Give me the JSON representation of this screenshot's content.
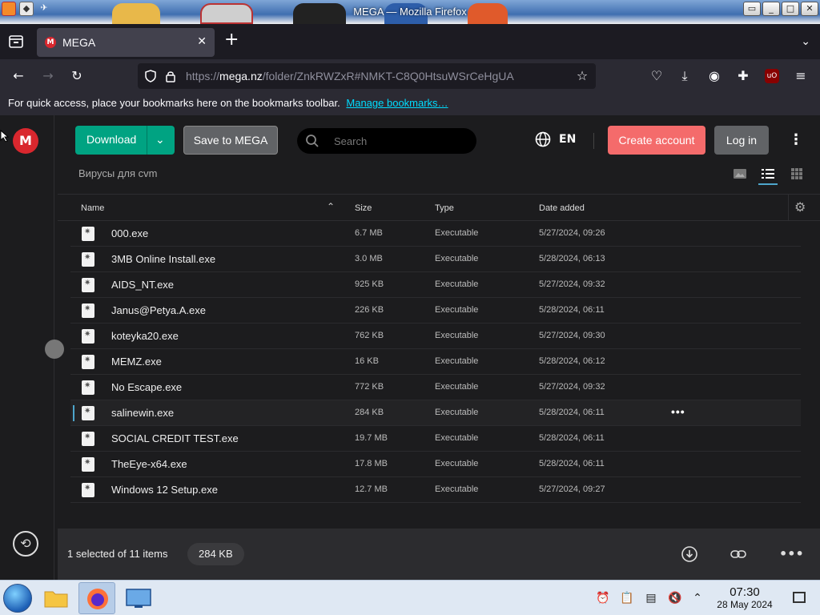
{
  "window": {
    "title": "MEGA — Mozilla Firefox"
  },
  "tabs": [
    {
      "label": "MEGA",
      "active": true
    }
  ],
  "urlbar": {
    "scheme": "https://",
    "domain": "mega.nz",
    "path": "/folder/ZnkRWZxR#NMKT-C8Q0HtsuWSrCeHgUA"
  },
  "bookmarks_bar": {
    "message": "For quick access, place your bookmarks here on the bookmarks toolbar.",
    "link": "Manage bookmarks…"
  },
  "toolbar": {
    "download_label": "Download",
    "save_label": "Save to MEGA",
    "search_placeholder": "Search",
    "language": "EN",
    "create_account_label": "Create account",
    "login_label": "Log in"
  },
  "breadcrumb": "Вирусы для cvm",
  "table": {
    "headers": {
      "name": "Name",
      "size": "Size",
      "type": "Type",
      "date": "Date added"
    },
    "rows": [
      {
        "name": "000.exe",
        "size": "6.7 MB",
        "type": "Executable",
        "date": "5/27/2024, 09:26",
        "selected": false
      },
      {
        "name": "3MB Online Install.exe",
        "size": "3.0 MB",
        "type": "Executable",
        "date": "5/28/2024, 06:13",
        "selected": false
      },
      {
        "name": "AIDS_NT.exe",
        "size": "925 KB",
        "type": "Executable",
        "date": "5/27/2024, 09:32",
        "selected": false
      },
      {
        "name": "Janus@Petya.A.exe",
        "size": "226 KB",
        "type": "Executable",
        "date": "5/28/2024, 06:11",
        "selected": false
      },
      {
        "name": "koteyka20.exe",
        "size": "762 KB",
        "type": "Executable",
        "date": "5/27/2024, 09:30",
        "selected": false
      },
      {
        "name": "MEMZ.exe",
        "size": "16 KB",
        "type": "Executable",
        "date": "5/28/2024, 06:12",
        "selected": false
      },
      {
        "name": "No Escape.exe",
        "size": "772 KB",
        "type": "Executable",
        "date": "5/27/2024, 09:32",
        "selected": false
      },
      {
        "name": "salinewin.exe",
        "size": "284 KB",
        "type": "Executable",
        "date": "5/28/2024, 06:11",
        "selected": true
      },
      {
        "name": "SOCIAL CREDIT TEST.exe",
        "size": "19.7 MB",
        "type": "Executable",
        "date": "5/28/2024, 06:11",
        "selected": false
      },
      {
        "name": "TheEye-x64.exe",
        "size": "17.8 MB",
        "type": "Executable",
        "date": "5/28/2024, 06:11",
        "selected": false
      },
      {
        "name": "Windows 12 Setup.exe",
        "size": "12.7 MB",
        "type": "Executable",
        "date": "5/27/2024, 09:27",
        "selected": false
      }
    ]
  },
  "footer": {
    "selection_text": "1 selected of 11 items",
    "selection_size": "284 KB"
  },
  "taskbar": {
    "time": "07:30",
    "date": "28 May 2024"
  },
  "colors": {
    "mega_red": "#d9272e",
    "download_green": "#00a382",
    "create_account": "#f46b6b",
    "accent_blue": "#4ea6cc"
  }
}
